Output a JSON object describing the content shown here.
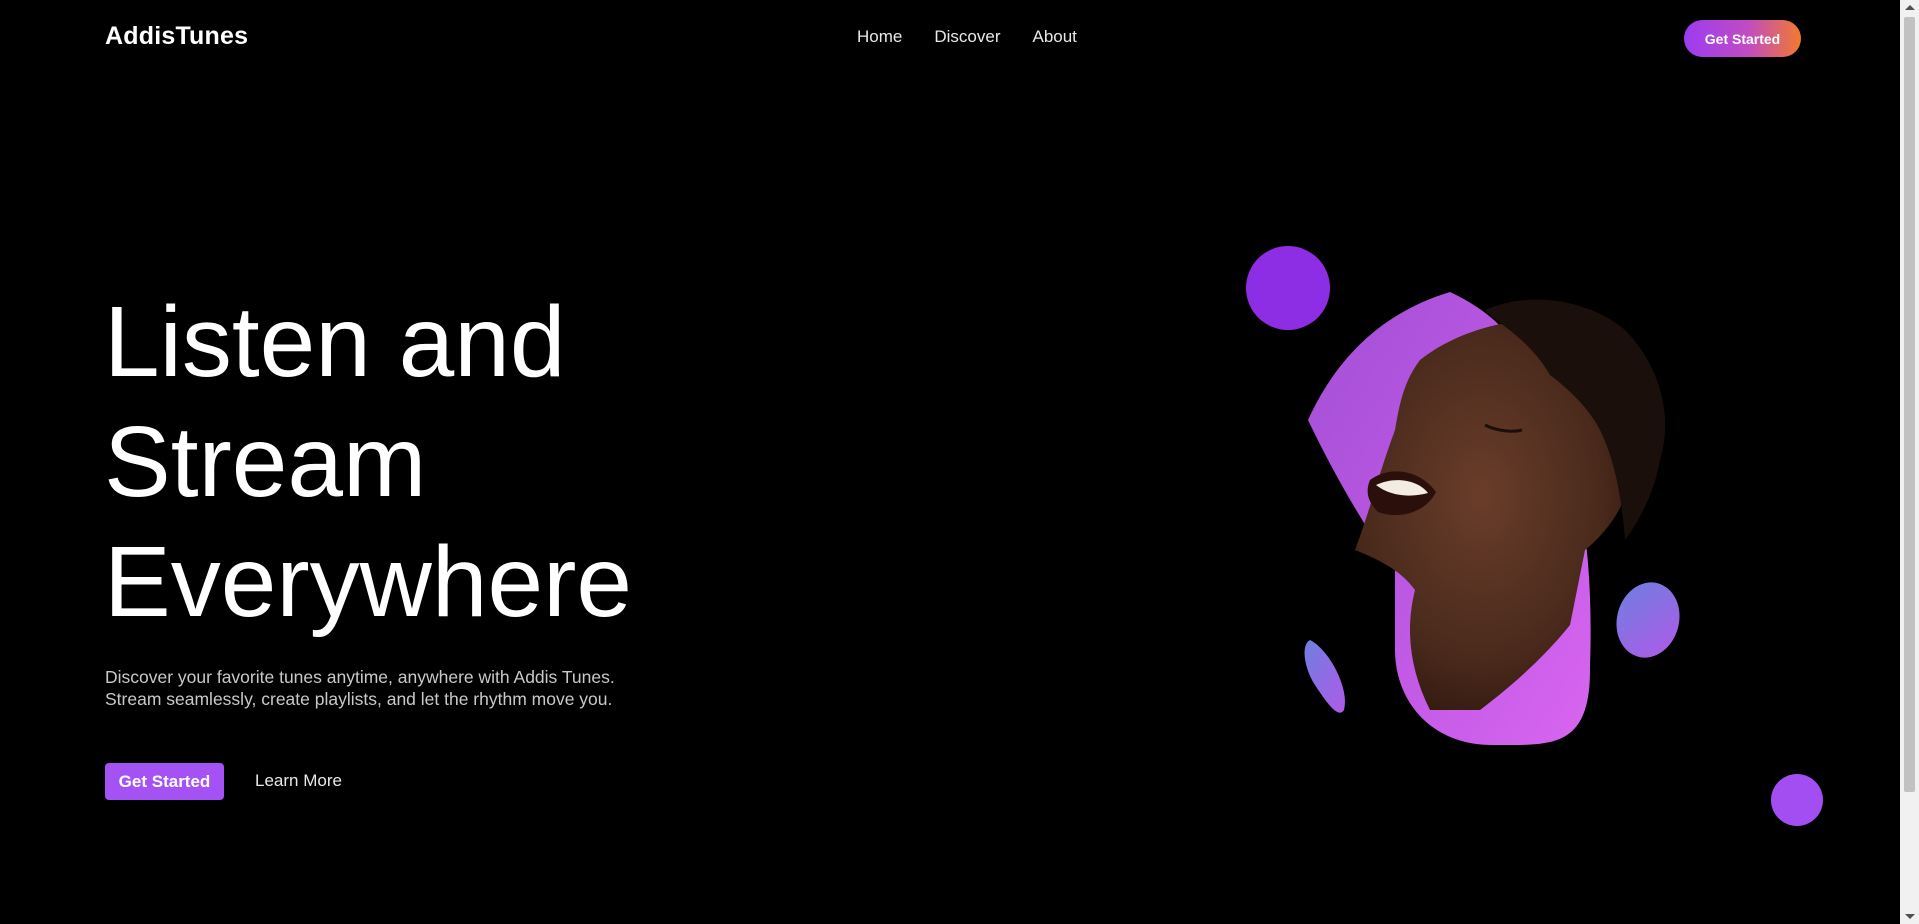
{
  "brand": {
    "name": "AddisTunes"
  },
  "nav": {
    "links": [
      {
        "label": "Home"
      },
      {
        "label": "Discover"
      },
      {
        "label": "About"
      }
    ],
    "cta_label": "Get Started"
  },
  "hero": {
    "title_lines": [
      "Listen and",
      "Stream",
      "Everywhere"
    ],
    "description": "Discover your favorite tunes anytime, anywhere with Addis Tunes. Stream seamlessly, create playlists, and let the rhythm move you.",
    "primary_button": "Get Started",
    "secondary_button": "Learn More"
  },
  "colors": {
    "background": "#000000",
    "accent_purple": "#a552f5",
    "gradient_start": "#9b3cf0",
    "gradient_end": "#f27a2c"
  }
}
